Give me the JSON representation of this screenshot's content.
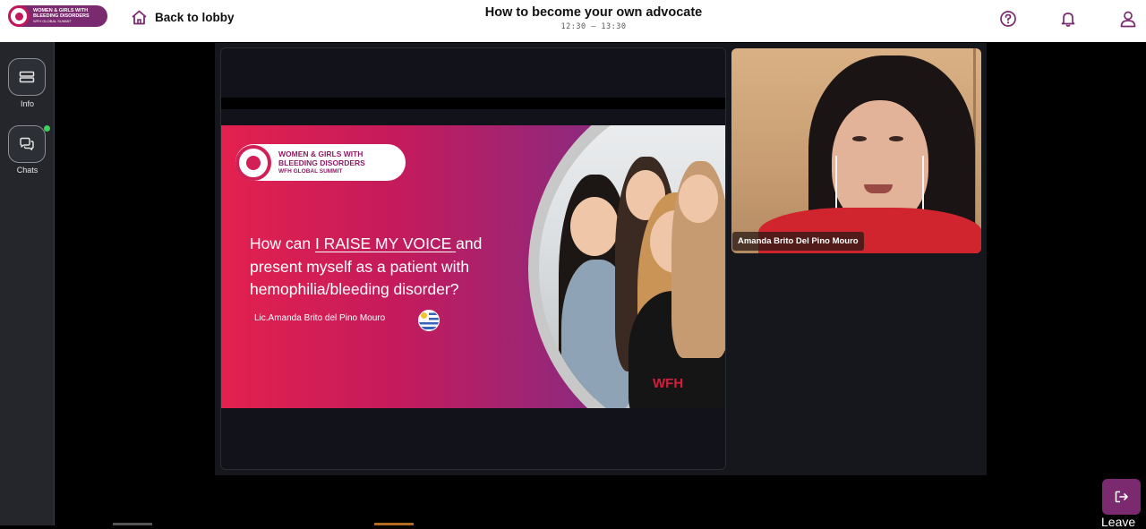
{
  "header": {
    "logo": {
      "line1": "WOMEN & GIRLS WITH",
      "line2": "BLEEDING DISORDERS",
      "line3": "WFH GLOBAL SUMMIT"
    },
    "back_label": "Back to lobby",
    "session_title": "How to become your own advocate",
    "session_time": "12:30 — 13:30",
    "icons": [
      "help-icon",
      "bell-icon",
      "user-icon"
    ],
    "accent_color": "#7a2a6e"
  },
  "sidebar": {
    "items": [
      {
        "label": "Info",
        "icon": "ticket-icon"
      },
      {
        "label": "Chats",
        "icon": "chat-bubbles-icon",
        "status_dot_color": "#3ecf5a"
      }
    ]
  },
  "slide": {
    "logo_line1": "WOMEN & GIRLS WITH",
    "logo_line2": "BLEEDING DISORDERS",
    "logo_line3": "WFH GLOBAL SUMMIT",
    "heading_pre": "How can ",
    "heading_underlined": "I RAISE MY VOICE ",
    "heading_post": "and present myself as a patient with hemophilia/bleeding disorder?",
    "presenter": "Lic.Amanda Brito del Pino Mouro",
    "brand_mark": "WFH"
  },
  "video": {
    "participant_name": "Amanda Brito Del Pino Mouro"
  },
  "leave": {
    "label": "Leave",
    "color": "#7b2a6f"
  }
}
